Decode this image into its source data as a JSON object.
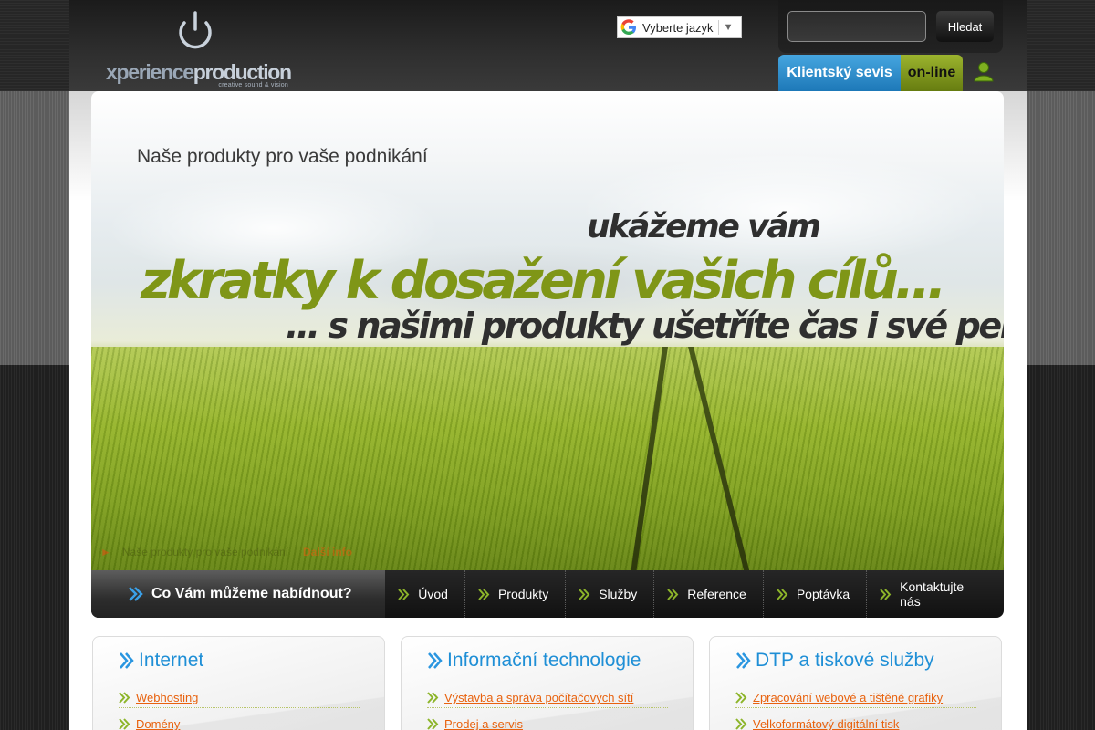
{
  "header": {
    "logo_text_light": "xperience",
    "logo_text_strong": "production",
    "logo_tagline": "creative sound & vision",
    "language_select_label": "Vyberte jazyk",
    "language_select_arrow": "▼",
    "search_placeholder": "",
    "search_button_label": "Hledat",
    "client_service_label": "Klientský sevis",
    "online_label": "on-line"
  },
  "hero": {
    "title": "Naše produkty pro vaše podnikání",
    "line1": "ukážeme vám",
    "line2": "zkratky k dosažení vašich cílů…",
    "line3": "… s našimi produkty ušetříte čas i své peníze",
    "caption": "Naše produkty pro vaše podnikání",
    "caption_link": "Další info"
  },
  "nav": {
    "lead_label": "Co Vám můžeme nabídnout?",
    "items": [
      {
        "label": "Úvod",
        "active": true
      },
      {
        "label": "Produkty"
      },
      {
        "label": "Služby"
      },
      {
        "label": "Reference"
      },
      {
        "label": "Poptávka"
      },
      {
        "label": "Kontaktujte nás"
      }
    ]
  },
  "boxes": [
    {
      "title": "Internet",
      "items": [
        "Webhosting",
        "Domény"
      ]
    },
    {
      "title": "Informační technologie",
      "items": [
        "Výstavba a správa počítačových sítí",
        "Prodej a servis"
      ]
    },
    {
      "title": "DTP a tiskové služby",
      "items": [
        "Zpracování webové a tištěné grafiky",
        "Velkoformátový digitální tisk"
      ]
    }
  ],
  "colors": {
    "accent_blue": "#1f8fd6",
    "accent_orange": "#e8620e",
    "accent_green": "#8db52a",
    "hero_green_text": "#7f9617",
    "dark_bg": "#1b1b1b"
  },
  "icons": {
    "logo": "power-icon",
    "language": "google-g-icon",
    "user": "user-icon",
    "nav_bullet": "double-chevron-green-icon",
    "lead_bullet": "double-chevron-blue-icon"
  }
}
